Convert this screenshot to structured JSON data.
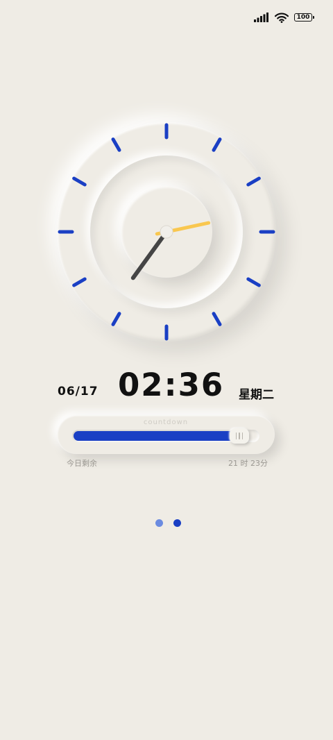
{
  "status_bar": {
    "icons": [
      "signal-icon",
      "wifi-icon",
      "battery-icon"
    ],
    "battery_level": "100"
  },
  "clock": {
    "hour": 2,
    "minute": 36,
    "tick_count": 12,
    "tick_color": "#1a3fc4",
    "hour_hand_color": "#f9c74f",
    "minute_hand_color": "#454545"
  },
  "datetime": {
    "date": "06/17",
    "time": "02:36",
    "weekday": "星期二"
  },
  "countdown": {
    "label": "countdown",
    "progress_percent": 89,
    "fill_color": "#1a3fc4",
    "remaining_label": "今日剩余",
    "remaining_value": "21 时 23分"
  },
  "pager": {
    "current_index": 1,
    "dots": [
      {
        "color": "#6b8be0"
      },
      {
        "color": "#1a3fc4"
      }
    ]
  }
}
